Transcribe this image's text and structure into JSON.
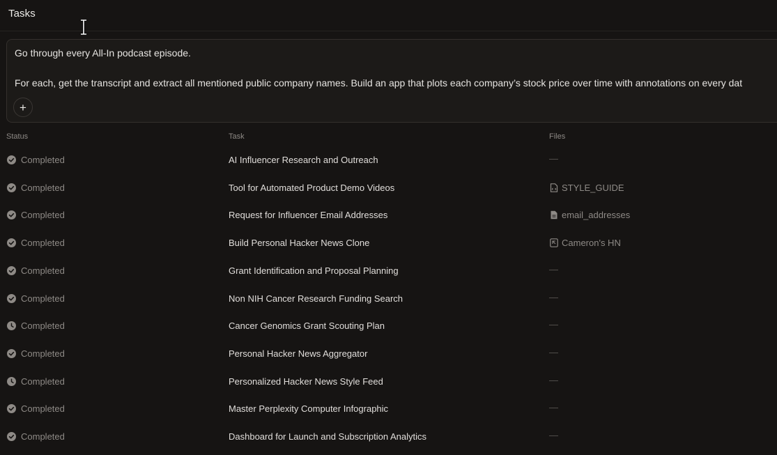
{
  "header": {
    "title": "Tasks"
  },
  "prompt": {
    "line1": "Go through every All-In podcast episode.",
    "line2": "For each, get the transcript and extract all mentioned public company names. Build an app that plots each company’s stock price over time with annotations on every dat",
    "add_label": "+"
  },
  "table": {
    "headers": {
      "status": "Status",
      "task": "Task",
      "files": "Files"
    },
    "rows": [
      {
        "status": "Completed",
        "status_icon": "check-circle-icon",
        "task": "AI Influencer Research and Outreach",
        "file": "",
        "file_icon": "",
        "empty": "—"
      },
      {
        "status": "Completed",
        "status_icon": "check-circle-icon",
        "task": "Tool for Automated Product Demo Videos",
        "file": "STYLE_GUIDE",
        "file_icon": "document-code-icon",
        "empty": ""
      },
      {
        "status": "Completed",
        "status_icon": "check-circle-icon",
        "task": "Request for Influencer Email Addresses",
        "file": "email_addresses",
        "file_icon": "document-icon",
        "empty": ""
      },
      {
        "status": "Completed",
        "status_icon": "check-circle-icon",
        "task": "Build Personal Hacker News Clone",
        "file": "Cameron's HN",
        "file_icon": "app-icon",
        "empty": ""
      },
      {
        "status": "Completed",
        "status_icon": "check-circle-icon",
        "task": "Grant Identification and Proposal Planning",
        "file": "",
        "file_icon": "",
        "empty": "—"
      },
      {
        "status": "Completed",
        "status_icon": "check-circle-icon",
        "task": "Non NIH Cancer Research Funding Search",
        "file": "",
        "file_icon": "",
        "empty": "—"
      },
      {
        "status": "Completed",
        "status_icon": "clock-icon",
        "task": "Cancer Genomics Grant Scouting Plan",
        "file": "",
        "file_icon": "",
        "empty": "—"
      },
      {
        "status": "Completed",
        "status_icon": "check-circle-icon",
        "task": "Personal Hacker News Aggregator",
        "file": "",
        "file_icon": "",
        "empty": "—"
      },
      {
        "status": "Completed",
        "status_icon": "clock-icon",
        "task": "Personalized Hacker News Style Feed",
        "file": "",
        "file_icon": "",
        "empty": "—"
      },
      {
        "status": "Completed",
        "status_icon": "check-circle-icon",
        "task": "Master Perplexity Computer Infographic",
        "file": "",
        "file_icon": "",
        "empty": "—"
      },
      {
        "status": "Completed",
        "status_icon": "check-circle-icon",
        "task": "Dashboard for Launch and Subscription Analytics",
        "file": "",
        "file_icon": "",
        "empty": "—"
      }
    ]
  },
  "colors": {
    "background": "#161413",
    "text_primary": "#e0ddda",
    "text_muted": "#8e8a86",
    "icon_fill": "#8e8a86"
  }
}
